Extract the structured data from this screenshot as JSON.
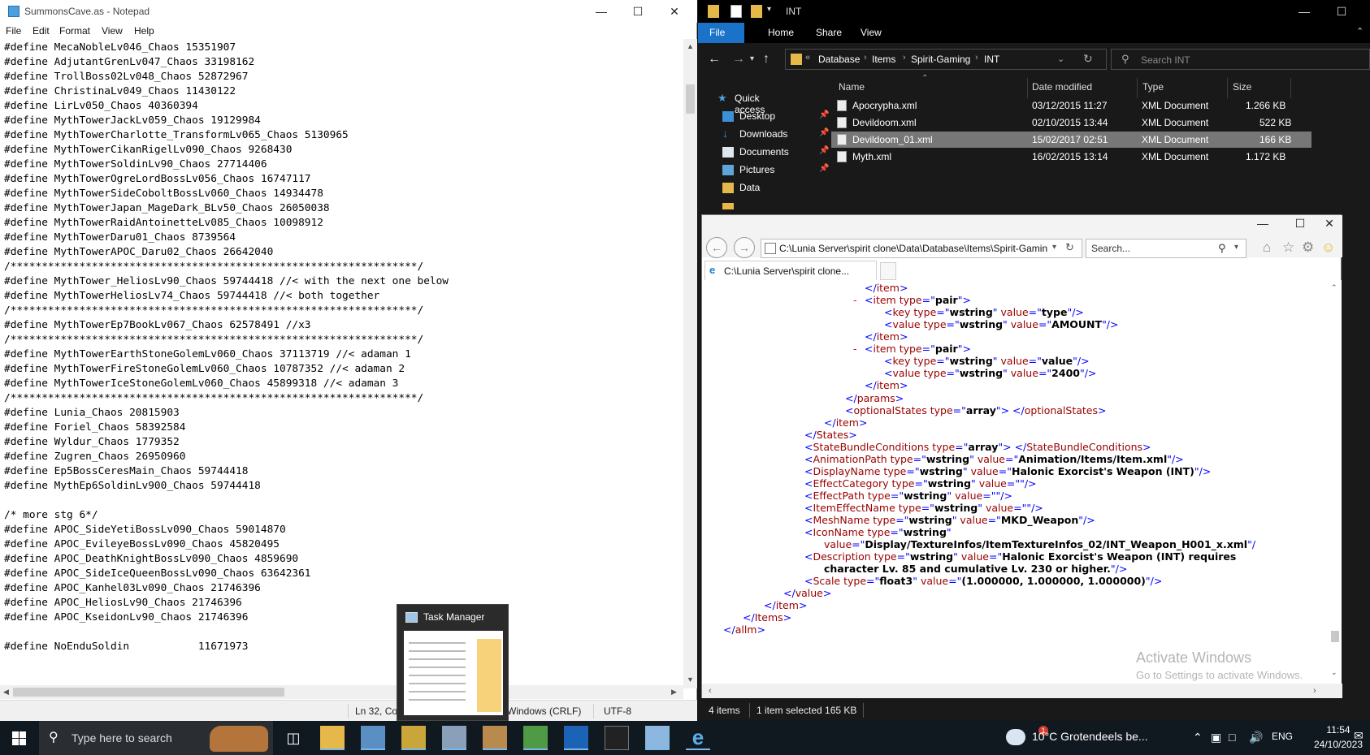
{
  "notepad": {
    "title": "SummonsCave.as - Notepad",
    "menu": [
      "File",
      "Edit",
      "Format",
      "View",
      "Help"
    ],
    "lines": [
      "#define MecaNobleLv046_Chaos 15351907",
      "#define AdjutantGrenLv047_Chaos 33198162",
      "#define TrollBoss02Lv048_Chaos 52872967",
      "#define ChristinaLv049_Chaos 11430122",
      "#define LirLv050_Chaos 40360394",
      "#define MythTowerJackLv059_Chaos 19129984",
      "#define MythTowerCharlotte_TransformLv065_Chaos 5130965",
      "#define MythTowerCikanRigelLv090_Chaos 9268430",
      "#define MythTowerSoldinLv90_Chaos 27714406",
      "#define MythTowerOgreLordBossLv056_Chaos 16747117",
      "#define MythTowerSideCoboltBossLv060_Chaos 14934478",
      "#define MythTowerJapan_MageDark_BLv50_Chaos 26050038",
      "#define MythTowerRaidAntoinetteLv085_Chaos 10098912",
      "#define MythTowerDaru01_Chaos 8739564",
      "#define MythTowerAPOC_Daru02_Chaos 26642040",
      "/*****************************************************************/",
      "#define MythTower_HeliosLv90_Chaos 59744418 //< with the next one below",
      "#define MythTowerHeliosLv74_Chaos 59744418 //< both together",
      "/*****************************************************************/",
      "#define MythTowerEp7BookLv067_Chaos 62578491 //x3",
      "/*****************************************************************/",
      "#define MythTowerEarthStoneGolemLv060_Chaos 37113719 //< adaman 1",
      "#define MythTowerFireStoneGolemLv060_Chaos 10787352 //< adaman 2",
      "#define MythTowerIceStoneGolemLv060_Chaos 45899318 //< adaman 3",
      "/*****************************************************************/",
      "#define Lunia_Chaos 20815903",
      "#define Foriel_Chaos 58392584",
      "#define Wyldur_Chaos 1779352",
      "#define Zugren_Chaos 26950960",
      "#define Ep5BossCeresMain_Chaos 59744418",
      "#define MythEp6SoldinLv900_Chaos 59744418",
      "",
      "/* more stg 6*/",
      "#define APOC_SideYetiBossLv090_Chaos 59014870",
      "#define APOC_EvileyeBossLv090_Chaos 45820495",
      "#define APOC_DeathKnightBossLv090_Chaos 4859690",
      "#define APOC_SideIceQueenBossLv090_Chaos 63642361",
      "#define APOC_Kanhel03Lv090_Chaos 21746396",
      "#define APOC_HeliosLv90_Chaos 21746396",
      "#define APOC_KseidonLv90_Chaos 21746396",
      "",
      "#define NoEnduSoldin           11671973"
    ],
    "status": {
      "position": "Ln 32, Co",
      "line_ending": "Windows (CRLF)",
      "encoding": "UTF-8"
    }
  },
  "explorer": {
    "title": "INT",
    "ribbon_tabs": [
      "File",
      "Home",
      "Share",
      "View"
    ],
    "breadcrumb": [
      "Database",
      "Items",
      "Spirit-Gaming",
      "INT"
    ],
    "search_placeholder": "Search INT",
    "nav": [
      {
        "label": "Quick access",
        "icon": "star-icon",
        "pinned": false
      },
      {
        "label": "Desktop",
        "icon": "desktop-icon",
        "pinned": true
      },
      {
        "label": "Downloads",
        "icon": "download-icon",
        "pinned": true
      },
      {
        "label": "Documents",
        "icon": "documents-icon",
        "pinned": true
      },
      {
        "label": "Pictures",
        "icon": "pictures-icon",
        "pinned": true
      },
      {
        "label": "Data",
        "icon": "folder-icon",
        "pinned": false
      }
    ],
    "columns": [
      "Name",
      "Date modified",
      "Type",
      "Size"
    ],
    "files": [
      {
        "name": "Apocrypha.xml",
        "date": "03/12/2015 11:27",
        "type": "XML Document",
        "size": "1.266 KB"
      },
      {
        "name": "Devildoom.xml",
        "date": "02/10/2015 13:44",
        "type": "XML Document",
        "size": "522 KB"
      },
      {
        "name": "Devildoom_01.xml",
        "date": "15/02/2017 02:51",
        "type": "XML Document",
        "size": "166 KB"
      },
      {
        "name": "Myth.xml",
        "date": "16/02/2015 13:14",
        "type": "XML Document",
        "size": "1.172 KB"
      }
    ],
    "status_items": "4 items",
    "status_selected": "1 item selected  165 KB"
  },
  "ie": {
    "address": "C:\\Lunia Server\\spirit clone\\Data\\Database\\Items\\Spirit-Gamin",
    "search_placeholder": "Search...",
    "tab_title": "C:\\Lunia Server\\spirit clone...",
    "xml_lines": [
      {
        "parts": [
          [
            "xp",
            "</"
          ],
          [
            "xt",
            "item"
          ],
          [
            "xp",
            ">"
          ]
        ]
      },
      {
        "minus": true,
        "parts": [
          [
            "xp",
            "<"
          ],
          [
            "xt",
            "item "
          ],
          [
            "xa",
            "type"
          ],
          [
            "xp",
            "=\""
          ],
          [
            "xv",
            "pair"
          ],
          [
            "xp",
            "\">"
          ]
        ]
      },
      {
        "parts": [
          [
            "xp",
            "<"
          ],
          [
            "xt",
            "key "
          ],
          [
            "xa",
            "type"
          ],
          [
            "xp",
            "=\""
          ],
          [
            "xv",
            "wstring"
          ],
          [
            "xp",
            "\" "
          ],
          [
            "xa",
            "value"
          ],
          [
            "xp",
            "=\""
          ],
          [
            "xv",
            "type"
          ],
          [
            "xp",
            "\"/>"
          ]
        ]
      },
      {
        "parts": [
          [
            "xp",
            "<"
          ],
          [
            "xt",
            "value "
          ],
          [
            "xa",
            "type"
          ],
          [
            "xp",
            "=\""
          ],
          [
            "xv",
            "wstring"
          ],
          [
            "xp",
            "\" "
          ],
          [
            "xa",
            "value"
          ],
          [
            "xp",
            "=\""
          ],
          [
            "xv",
            "AMOUNT"
          ],
          [
            "xp",
            "\"/>"
          ]
        ]
      },
      {
        "parts": [
          [
            "xp",
            "</"
          ],
          [
            "xt",
            "item"
          ],
          [
            "xp",
            ">"
          ]
        ]
      },
      {
        "minus": true,
        "parts": [
          [
            "xp",
            "<"
          ],
          [
            "xt",
            "item "
          ],
          [
            "xa",
            "type"
          ],
          [
            "xp",
            "=\""
          ],
          [
            "xv",
            "pair"
          ],
          [
            "xp",
            "\">"
          ]
        ]
      },
      {
        "parts": [
          [
            "xp",
            "<"
          ],
          [
            "xt",
            "key "
          ],
          [
            "xa",
            "type"
          ],
          [
            "xp",
            "=\""
          ],
          [
            "xv",
            "wstring"
          ],
          [
            "xp",
            "\" "
          ],
          [
            "xa",
            "value"
          ],
          [
            "xp",
            "=\""
          ],
          [
            "xv",
            "value"
          ],
          [
            "xp",
            "\"/>"
          ]
        ]
      },
      {
        "parts": [
          [
            "xp",
            "<"
          ],
          [
            "xt",
            "value "
          ],
          [
            "xa",
            "type"
          ],
          [
            "xp",
            "=\""
          ],
          [
            "xv",
            "wstring"
          ],
          [
            "xp",
            "\" "
          ],
          [
            "xa",
            "value"
          ],
          [
            "xp",
            "=\""
          ],
          [
            "xv",
            "2400"
          ],
          [
            "xp",
            "\"/>"
          ]
        ]
      },
      {
        "parts": [
          [
            "xp",
            "</"
          ],
          [
            "xt",
            "item"
          ],
          [
            "xp",
            ">"
          ]
        ]
      },
      {
        "parts": [
          [
            "xp",
            "</"
          ],
          [
            "xt",
            "params"
          ],
          [
            "xp",
            ">"
          ]
        ]
      },
      {
        "parts": [
          [
            "xp",
            "<"
          ],
          [
            "xt",
            "optionalStates "
          ],
          [
            "xa",
            "type"
          ],
          [
            "xp",
            "=\""
          ],
          [
            "xv",
            "array"
          ],
          [
            "xp",
            "\"> </"
          ],
          [
            "xt",
            "optionalStates"
          ],
          [
            "xp",
            ">"
          ]
        ]
      },
      {
        "parts": [
          [
            "xp",
            "</"
          ],
          [
            "xt",
            "item"
          ],
          [
            "xp",
            ">"
          ]
        ]
      },
      {
        "parts": [
          [
            "xp",
            "</"
          ],
          [
            "xt",
            "States"
          ],
          [
            "xp",
            ">"
          ]
        ]
      },
      {
        "parts": [
          [
            "xp",
            "<"
          ],
          [
            "xt",
            "StateBundleConditions "
          ],
          [
            "xa",
            "type"
          ],
          [
            "xp",
            "=\""
          ],
          [
            "xv",
            "array"
          ],
          [
            "xp",
            "\"> </"
          ],
          [
            "xt",
            "StateBundleConditions"
          ],
          [
            "xp",
            ">"
          ]
        ]
      },
      {
        "parts": [
          [
            "xp",
            "<"
          ],
          [
            "xt",
            "AnimationPath "
          ],
          [
            "xa",
            "type"
          ],
          [
            "xp",
            "=\""
          ],
          [
            "xv",
            "wstring"
          ],
          [
            "xp",
            "\" "
          ],
          [
            "xa",
            "value"
          ],
          [
            "xp",
            "=\""
          ],
          [
            "xv",
            "Animation/Items/Item.xml"
          ],
          [
            "xp",
            "\"/>"
          ]
        ]
      },
      {
        "parts": [
          [
            "xp",
            "<"
          ],
          [
            "xt",
            "DisplayName "
          ],
          [
            "xa",
            "type"
          ],
          [
            "xp",
            "=\""
          ],
          [
            "xv",
            "wstring"
          ],
          [
            "xp",
            "\" "
          ],
          [
            "xa",
            "value"
          ],
          [
            "xp",
            "=\""
          ],
          [
            "xv",
            "Halonic Exorcist's Weapon (INT)"
          ],
          [
            "xp",
            "\"/>"
          ]
        ]
      },
      {
        "parts": [
          [
            "xp",
            "<"
          ],
          [
            "xt",
            "EffectCategory "
          ],
          [
            "xa",
            "type"
          ],
          [
            "xp",
            "=\""
          ],
          [
            "xv",
            "wstring"
          ],
          [
            "xp",
            "\" "
          ],
          [
            "xa",
            "value"
          ],
          [
            "xp",
            "=\"\"/>"
          ]
        ]
      },
      {
        "parts": [
          [
            "xp",
            "<"
          ],
          [
            "xt",
            "EffectPath "
          ],
          [
            "xa",
            "type"
          ],
          [
            "xp",
            "=\""
          ],
          [
            "xv",
            "wstring"
          ],
          [
            "xp",
            "\" "
          ],
          [
            "xa",
            "value"
          ],
          [
            "xp",
            "=\"\"/>"
          ]
        ]
      },
      {
        "parts": [
          [
            "xp",
            "<"
          ],
          [
            "xt",
            "ItemEffectName "
          ],
          [
            "xa",
            "type"
          ],
          [
            "xp",
            "=\""
          ],
          [
            "xv",
            "wstring"
          ],
          [
            "xp",
            "\" "
          ],
          [
            "xa",
            "value"
          ],
          [
            "xp",
            "=\"\"/>"
          ]
        ]
      },
      {
        "parts": [
          [
            "xp",
            "<"
          ],
          [
            "xt",
            "MeshName "
          ],
          [
            "xa",
            "type"
          ],
          [
            "xp",
            "=\""
          ],
          [
            "xv",
            "wstring"
          ],
          [
            "xp",
            "\" "
          ],
          [
            "xa",
            "value"
          ],
          [
            "xp",
            "=\""
          ],
          [
            "xv",
            "MKD_Weapon"
          ],
          [
            "xp",
            "\"/>"
          ]
        ]
      },
      {
        "parts": [
          [
            "xp",
            "<"
          ],
          [
            "xt",
            "IconName "
          ],
          [
            "xa",
            "type"
          ],
          [
            "xp",
            "=\""
          ],
          [
            "xv",
            "wstring"
          ],
          [
            "xp",
            "\""
          ]
        ]
      },
      {
        "parts": [
          [
            "xa",
            "value"
          ],
          [
            "xp",
            "=\""
          ],
          [
            "xv",
            "Display/TextureInfos/ItemTextureInfos_02/INT_Weapon_H001_x.xml"
          ],
          [
            "xp",
            "\"/"
          ]
        ]
      },
      {
        "parts": [
          [
            "xp",
            "<"
          ],
          [
            "xt",
            "Description "
          ],
          [
            "xa",
            "type"
          ],
          [
            "xp",
            "=\""
          ],
          [
            "xv",
            "wstring"
          ],
          [
            "xp",
            "\" "
          ],
          [
            "xa",
            "value"
          ],
          [
            "xp",
            "=\""
          ],
          [
            "xv",
            "Halonic Exorcist's Weapon (INT) requires"
          ]
        ]
      },
      {
        "parts": [
          [
            "xv",
            "character Lv. 85 and cumulative Lv. 230 or higher."
          ],
          [
            "xp",
            "\"/>"
          ]
        ]
      },
      {
        "parts": [
          [
            "xp",
            "<"
          ],
          [
            "xt",
            "Scale "
          ],
          [
            "xa",
            "type"
          ],
          [
            "xp",
            "=\""
          ],
          [
            "xv",
            "float3"
          ],
          [
            "xp",
            "\" "
          ],
          [
            "xa",
            "value"
          ],
          [
            "xp",
            "=\""
          ],
          [
            "xv",
            "(1.000000, 1.000000, 1.000000)"
          ],
          [
            "xp",
            "\"/>"
          ]
        ]
      },
      {
        "parts": [
          [
            "xp",
            "</"
          ],
          [
            "xt",
            "value"
          ],
          [
            "xp",
            ">"
          ]
        ]
      },
      {
        "parts": [
          [
            "xp",
            "</"
          ],
          [
            "xt",
            "item"
          ],
          [
            "xp",
            ">"
          ]
        ]
      },
      {
        "parts": [
          [
            "xp",
            "</"
          ],
          [
            "xt",
            "Items"
          ],
          [
            "xp",
            ">"
          ]
        ]
      },
      {
        "parts": [
          [
            "xp",
            "</"
          ],
          [
            "xt",
            "allm"
          ],
          [
            "xp",
            ">"
          ]
        ]
      }
    ]
  },
  "watermark": {
    "line1": "Activate Windows",
    "line2": "Go to Settings to activate Windows."
  },
  "task_thumbnail": {
    "title": "Task Manager"
  },
  "taskbar": {
    "search_placeholder": "Type here to search",
    "weather": "10°C  Grotendeels be...",
    "weather_badge": "1",
    "language": "ENG",
    "time": "11:54",
    "date": "24/10/2023"
  }
}
